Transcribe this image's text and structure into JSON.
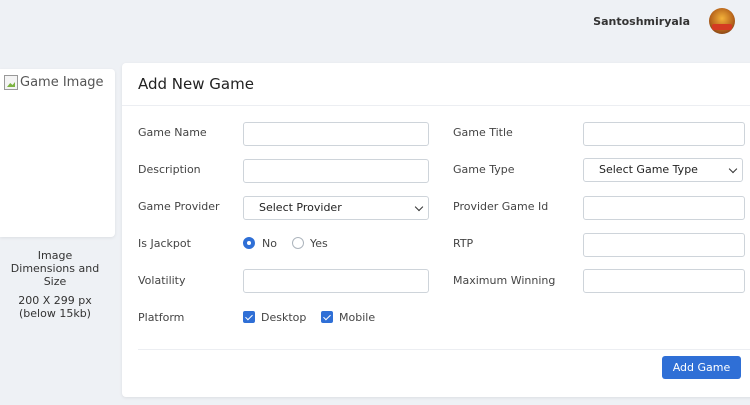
{
  "header": {
    "username": "Santoshmiryala"
  },
  "image_panel": {
    "placeholder_alt": "Game Image",
    "info_line1": "Image",
    "info_line2": "Dimensions and Size",
    "info_line3": "200 X 299 px",
    "info_line4": "(below 15kb)"
  },
  "form": {
    "title": "Add New Game",
    "game_name_label": "Game Name",
    "game_title_label": "Game Title",
    "description_label": "Description",
    "game_type_label": "Game Type",
    "game_type_selected": "Select Game Type",
    "game_provider_label": "Game Provider",
    "game_provider_selected": "Select Provider",
    "provider_game_id_label": "Provider Game Id",
    "is_jackpot_label": "Is Jackpot",
    "jackpot_no": "No",
    "jackpot_yes": "Yes",
    "rtp_label": "RTP",
    "volatility_label": "Volatility",
    "maximum_winning_label": "Maximum Winning",
    "platform_label": "Platform",
    "platform_desktop": "Desktop",
    "platform_mobile": "Mobile",
    "submit_label": "Add Game"
  },
  "colors": {
    "primary": "#2f6fd6",
    "background": "#eef1f5"
  }
}
